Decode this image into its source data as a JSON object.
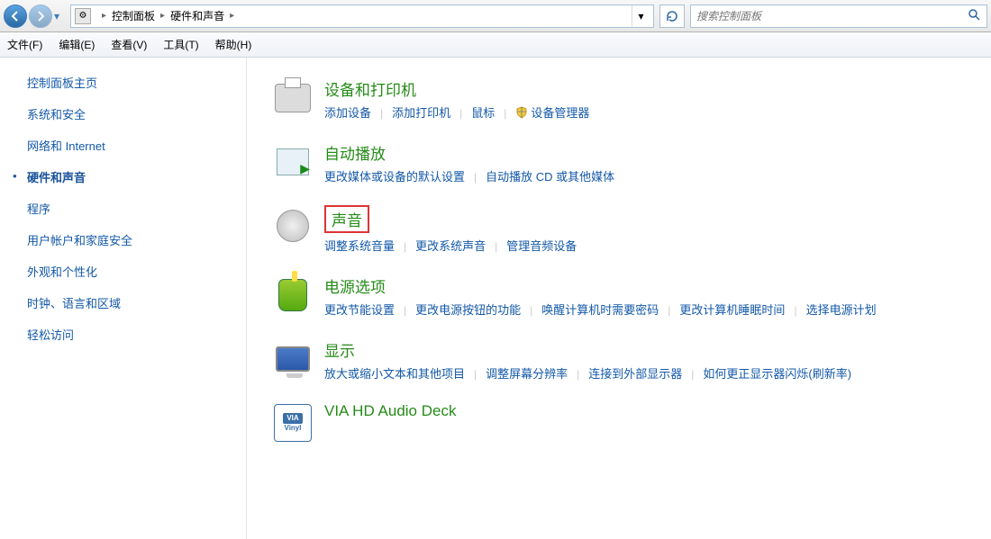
{
  "nav": {
    "breadcrumb": [
      "控制面板",
      "硬件和声音"
    ],
    "search_placeholder": "搜索控制面板"
  },
  "menu": {
    "file": "文件(F)",
    "edit": "编辑(E)",
    "view": "查看(V)",
    "tools": "工具(T)",
    "help": "帮助(H)"
  },
  "sidebar": [
    {
      "label": "控制面板主页",
      "active": false
    },
    {
      "label": "系统和安全",
      "active": false
    },
    {
      "label": "网络和 Internet",
      "active": false
    },
    {
      "label": "硬件和声音",
      "active": true
    },
    {
      "label": "程序",
      "active": false
    },
    {
      "label": "用户帐户和家庭安全",
      "active": false
    },
    {
      "label": "外观和个性化",
      "active": false
    },
    {
      "label": "时钟、语言和区域",
      "active": false
    },
    {
      "label": "轻松访问",
      "active": false
    }
  ],
  "categories": [
    {
      "title": "设备和打印机",
      "icon": "printer",
      "links": [
        {
          "label": "添加设备"
        },
        {
          "label": "添加打印机"
        },
        {
          "label": "鼠标"
        },
        {
          "label": "设备管理器",
          "shield": true
        }
      ]
    },
    {
      "title": "自动播放",
      "icon": "autoplay",
      "links": [
        {
          "label": "更改媒体或设备的默认设置"
        },
        {
          "label": "自动播放 CD 或其他媒体"
        }
      ]
    },
    {
      "title": "声音",
      "icon": "sound",
      "highlighted": true,
      "links": [
        {
          "label": "调整系统音量"
        },
        {
          "label": "更改系统声音"
        },
        {
          "label": "管理音频设备"
        }
      ]
    },
    {
      "title": "电源选项",
      "icon": "power",
      "links": [
        {
          "label": "更改节能设置"
        },
        {
          "label": "更改电源按钮的功能"
        },
        {
          "label": "唤醒计算机时需要密码"
        },
        {
          "label": "更改计算机睡眠时间"
        },
        {
          "label": "选择电源计划"
        }
      ]
    },
    {
      "title": "显示",
      "icon": "display",
      "links": [
        {
          "label": "放大或缩小文本和其他项目"
        },
        {
          "label": "调整屏幕分辨率"
        },
        {
          "label": "连接到外部显示器"
        },
        {
          "label": "如何更正显示器闪烁(刷新率)"
        }
      ]
    },
    {
      "title": "VIA HD Audio Deck",
      "icon": "via",
      "links": []
    }
  ]
}
